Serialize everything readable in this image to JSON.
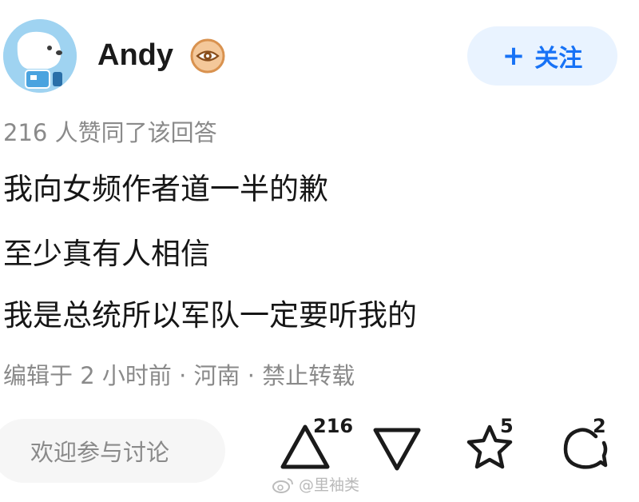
{
  "author": {
    "name": "Andy",
    "avatar_icon": "astronaut-dog-avatar",
    "badge_icon": "eye-badge-icon"
  },
  "follow_button": {
    "plus": "+",
    "label": "关注"
  },
  "upvote_summary": "216 人赞同了该回答",
  "content": {
    "line1": "我向女频作者道一半的歉",
    "line2": "至少真有人相信",
    "line3": "我是总统所以军队一定要听我的"
  },
  "meta": "编辑于 2 小时前 · 河南 · 禁止转载",
  "bottom_bar": {
    "comment_placeholder": "欢迎参与讨论",
    "upvote_count": "216",
    "favorite_count": "5",
    "comment_count": "2"
  },
  "watermark": "@里袖类",
  "colors": {
    "accent": "#1772f6",
    "follow_bg": "#e9f3ff",
    "secondary_text": "#8a8a8a",
    "avatar_bg": "#9fd3f1",
    "badge_ring": "#d9924f"
  }
}
